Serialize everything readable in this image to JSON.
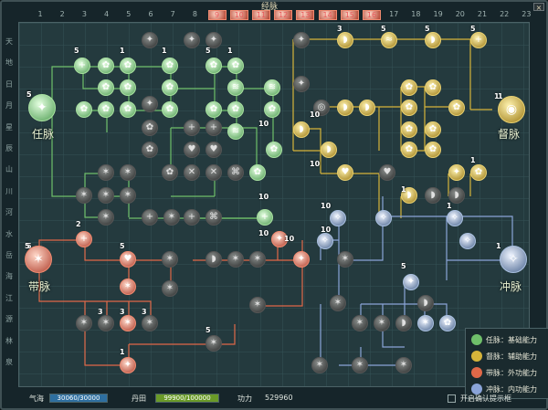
{
  "window": {
    "title": "经脉",
    "close_glyph": "×"
  },
  "columns": [
    "1",
    "2",
    "3",
    "4",
    "5",
    "6",
    "7",
    "8",
    "9",
    "10",
    "11",
    "12",
    "13",
    "14",
    "15",
    "16",
    "17",
    "18",
    "19",
    "20",
    "21",
    "22",
    "23"
  ],
  "highlighted_columns": [
    "9",
    "10",
    "11",
    "12",
    "13",
    "14",
    "15",
    "16"
  ],
  "rows": [
    "天",
    "地",
    "日",
    "月",
    "星",
    "辰",
    "山",
    "川",
    "河",
    "水",
    "岳",
    "海",
    "江",
    "源",
    "林",
    "泉"
  ],
  "meridians": {
    "ren": {
      "label": "任脉",
      "level": "5",
      "color": "#6fbf6a"
    },
    "du": {
      "label": "督脉",
      "level": "1",
      "color": "#d6b43a"
    },
    "dai": {
      "label": "带脉",
      "level": "5",
      "color": "#e06848"
    },
    "chong": {
      "label": "冲脉",
      "level": "1",
      "color": "#8aa4d8"
    }
  },
  "legend": [
    {
      "label": "任脉：基础能力",
      "color": "#6fbf6a"
    },
    {
      "label": "督脉：辅助能力",
      "color": "#d6b43a"
    },
    {
      "label": "带脉：外功能力",
      "color": "#e06848"
    },
    {
      "label": "冲脉：内功能力",
      "color": "#8aa4d8"
    }
  ],
  "footer": {
    "qihai_label": "气海",
    "qihai_value": "30060/30000",
    "qihai_fill": 1.0,
    "dantian_label": "丹田",
    "dantian_value": "99900/100000",
    "dantian_fill": 0.999,
    "gongli_label": "功力",
    "gongli_value": "529960",
    "checkbox_label": "开启确认提示框"
  },
  "node_numbers": [
    "5",
    "1",
    "1",
    "5",
    "1",
    "10",
    "10",
    "10",
    "10",
    "10",
    "3",
    "5",
    "5",
    "5",
    "1",
    "2",
    "5",
    "10",
    "10",
    "10",
    "3",
    "3",
    "3",
    "1",
    "5",
    "1",
    "5",
    "1",
    "1",
    "5",
    "5"
  ]
}
